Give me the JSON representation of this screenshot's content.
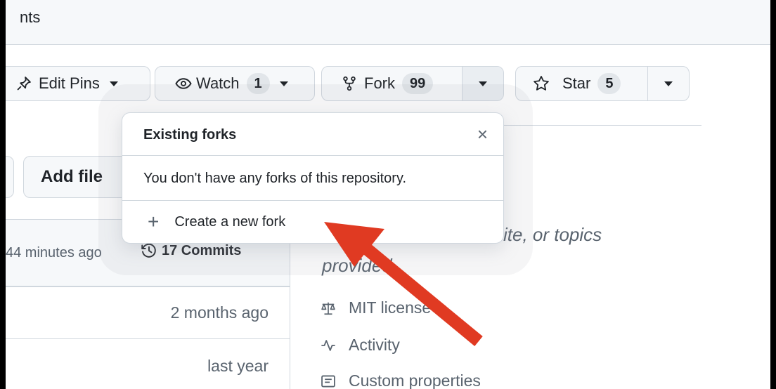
{
  "tab": {
    "partial_label": "nts"
  },
  "actions": {
    "pins_label": "Edit Pins",
    "watch_label": "Watch",
    "watch_count": "1",
    "fork_label": "Fork",
    "fork_count": "99",
    "star_label": "Star",
    "star_count": "5"
  },
  "code": {
    "add_file_label": "Add file",
    "last_commit_time": "44 minutes ago",
    "commits_label": "17 Commits",
    "rows": [
      {
        "time": "2 months ago"
      },
      {
        "time": "last year"
      }
    ]
  },
  "about": {
    "description_line1": "site, or topics",
    "description_line2": "provided.",
    "license": "MIT license",
    "activity": "Activity",
    "custom_properties": "Custom properties"
  },
  "fork_popover": {
    "title": "Existing forks",
    "close_glyph": "×",
    "empty_message": "You don't have any forks of this repository.",
    "create_label": "Create a new fork"
  },
  "annotation": {
    "arrow_color": "#e03a22"
  },
  "icons": {
    "pin": "pin-icon",
    "eye": "eye-icon",
    "fork": "repo-forked-icon",
    "star": "star-icon",
    "history": "history-icon",
    "law": "law-icon",
    "pulse": "pulse-icon",
    "note": "note-icon",
    "plus": "plus-icon"
  }
}
